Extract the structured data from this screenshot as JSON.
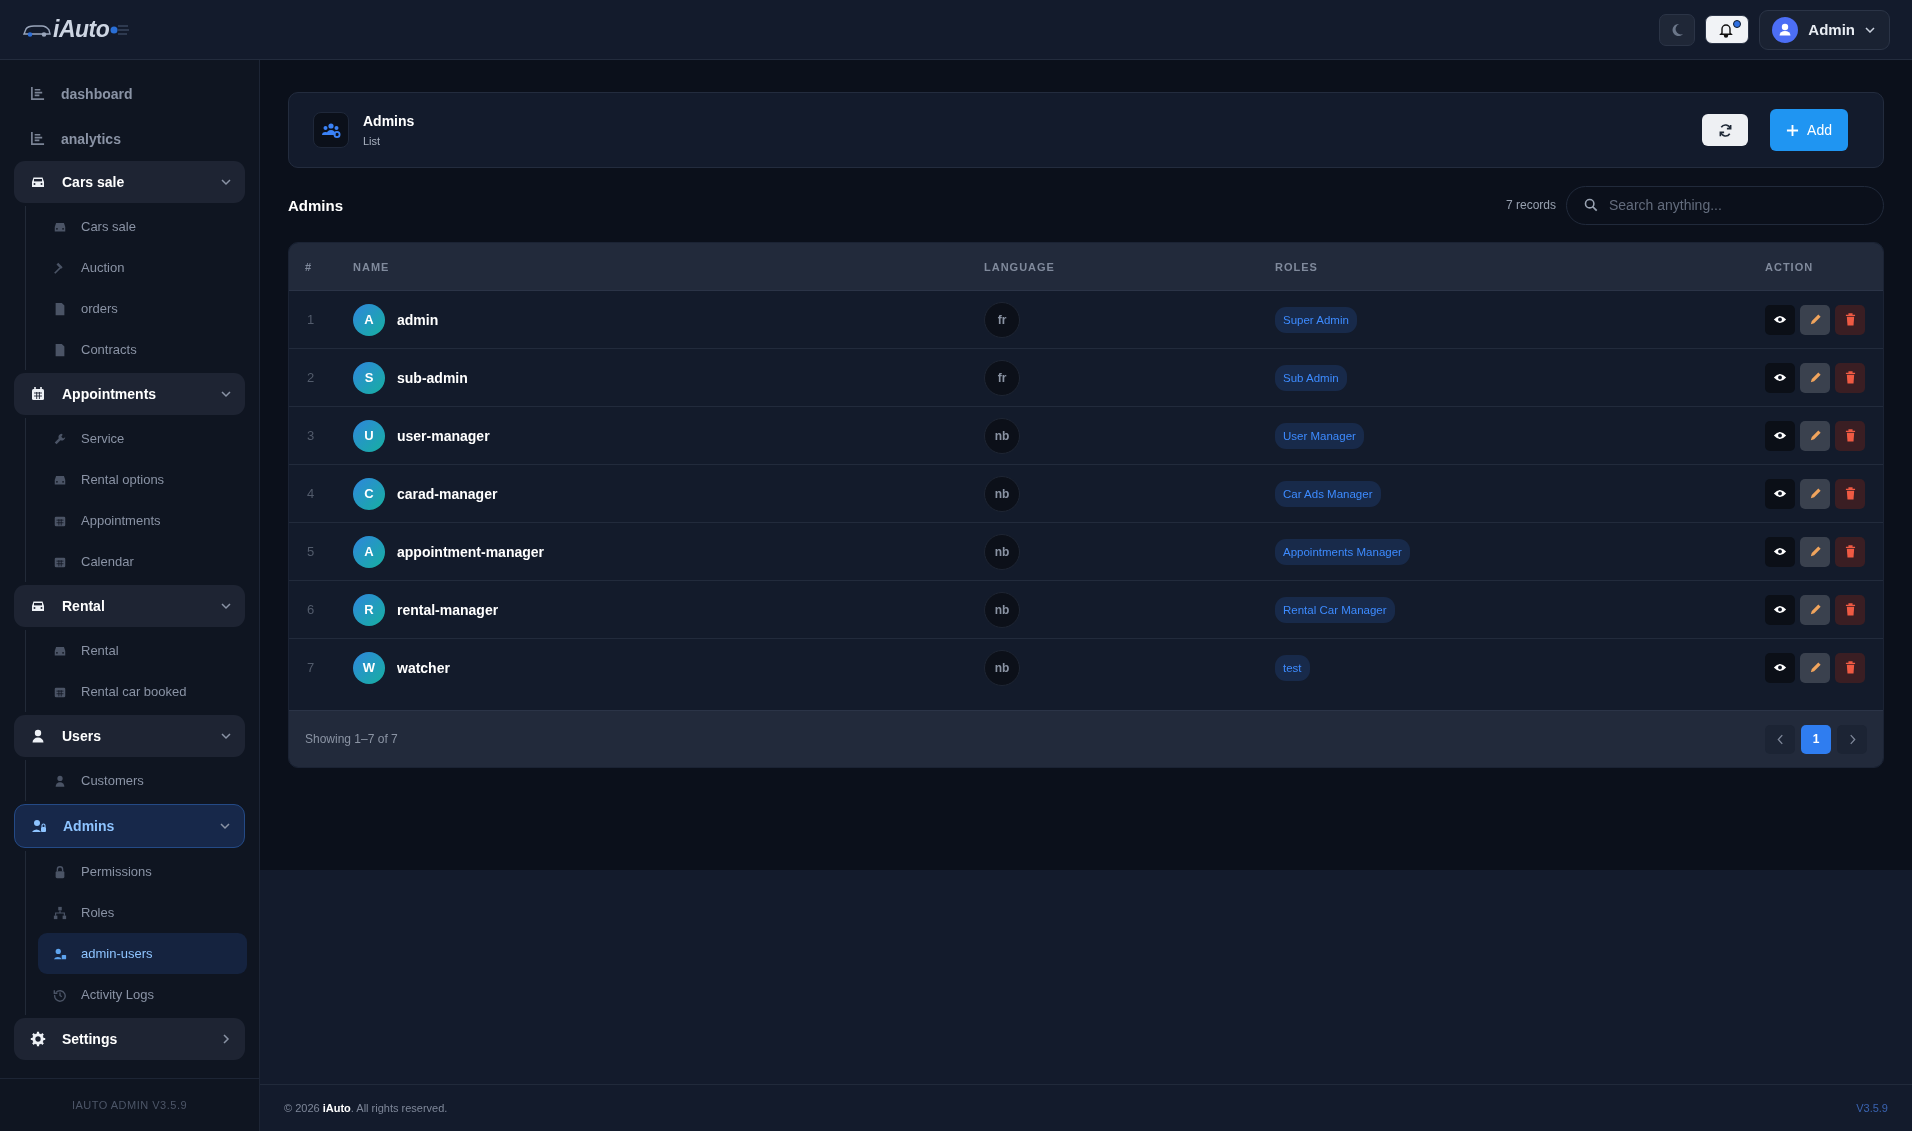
{
  "brand": {
    "logo": "iAuto"
  },
  "topbar": {
    "theme_button": {
      "kind": "moon"
    },
    "notifications": {
      "unread": true
    },
    "user": {
      "name": "Admin"
    }
  },
  "sidebar": {
    "items": [
      {
        "kind": "link",
        "label": "dashboard",
        "selected": false
      },
      {
        "kind": "link",
        "label": "analytics",
        "selected": false
      },
      {
        "kind": "group",
        "label": "Cars sale",
        "selected": false,
        "expanded": true,
        "children": [
          {
            "label": "Cars sale",
            "selected": false
          },
          {
            "label": "Auction",
            "selected": false
          },
          {
            "label": "orders",
            "selected": false
          },
          {
            "label": "Contracts",
            "selected": false
          }
        ]
      },
      {
        "kind": "group",
        "label": "Appointments",
        "selected": false,
        "expanded": true,
        "children": [
          {
            "label": "Service",
            "selected": false
          },
          {
            "label": "Rental options",
            "selected": false
          },
          {
            "label": "Appointments",
            "selected": false
          },
          {
            "label": "Calendar",
            "selected": false
          }
        ]
      },
      {
        "kind": "group",
        "label": "Rental",
        "selected": false,
        "expanded": true,
        "children": [
          {
            "label": "Rental",
            "selected": false
          },
          {
            "label": "Rental car booked",
            "selected": false
          }
        ]
      },
      {
        "kind": "group",
        "label": "Users",
        "selected": false,
        "expanded": true,
        "children": [
          {
            "label": "Customers",
            "selected": false
          }
        ]
      },
      {
        "kind": "group",
        "label": "Admins",
        "selected": true,
        "expanded": true,
        "children": [
          {
            "label": "Permissions",
            "selected": false
          },
          {
            "label": "Roles",
            "selected": false
          },
          {
            "label": "admin-users",
            "selected": true
          },
          {
            "label": "Activity Logs",
            "selected": false
          }
        ]
      },
      {
        "kind": "group",
        "label": "Settings",
        "selected": false,
        "expanded": false
      }
    ],
    "version": "IAUTO ADMIN V3.5.9"
  },
  "page_header": {
    "title": "Admins",
    "subtitle": "List",
    "add_button": "Add"
  },
  "list": {
    "title": "Admins",
    "records": "7 records",
    "search": {
      "placeholder": "Search anything..."
    },
    "table": {
      "columns": [
        "#",
        "NAME",
        "LANGUAGE",
        "ROLES",
        "ACTION"
      ],
      "rows": [
        {
          "number": "1",
          "initial": "A",
          "name": "admin",
          "language": "fr",
          "role": "Super Admin"
        },
        {
          "number": "2",
          "initial": "S",
          "name": "sub-admin",
          "language": "fr",
          "role": "Sub Admin"
        },
        {
          "number": "3",
          "initial": "U",
          "name": "user-manager",
          "language": "nb",
          "role": "User Manager"
        },
        {
          "number": "4",
          "initial": "C",
          "name": "carad-manager",
          "language": "nb",
          "role": "Car Ads Manager"
        },
        {
          "number": "5",
          "initial": "A",
          "name": "appointment-manager",
          "language": "nb",
          "role": "Appointments Manager"
        },
        {
          "number": "6",
          "initial": "R",
          "name": "rental-manager",
          "language": "nb",
          "role": "Rental Car Manager"
        },
        {
          "number": "7",
          "initial": "W",
          "name": "watcher",
          "language": "nb",
          "role": "test"
        }
      ]
    },
    "showing": "Showing 1–7 of 7",
    "pages": [
      {
        "label": "1",
        "selected": true
      }
    ]
  },
  "footer": {
    "copyright": "© 2026 **iAuto**. All rights reserved.",
    "version": "V3.5.9"
  }
}
